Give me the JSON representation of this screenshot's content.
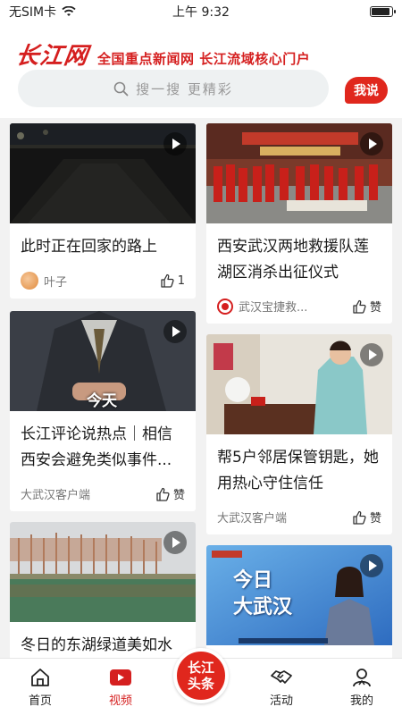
{
  "status_bar": {
    "carrier": "无SIM卡",
    "time": "上午 9:32",
    "battery_level": 0.9
  },
  "header": {
    "logo": "长江网",
    "slogan": "全国重点新闻网 长江流域核心门户",
    "search_placeholder": "搜一搜 更精彩",
    "say_button": "我说"
  },
  "feed": {
    "cards": [
      {
        "title": "此时正在回家的路上",
        "source": "叶子",
        "likes": "1",
        "thumb": "night-road"
      },
      {
        "title": "西安武汉两地救援队莲湖区消杀出征仪式",
        "source": "武汉宝捷救...",
        "likes": "赞",
        "thumb": "rescue-team"
      },
      {
        "title": "长江评论说热点｜相信西安会避免类似事件...",
        "source": "大武汉客户端",
        "likes": "赞",
        "thumb": "suit-man",
        "thumb_caption": "今天"
      },
      {
        "title": "帮5户邻居保管钥匙，她用热心守住信任",
        "source": "大武汉客户端",
        "likes": "赞",
        "thumb": "woman-keys"
      },
      {
        "title": "冬日的东湖绿道美如水",
        "source": "",
        "likes": "",
        "thumb": "east-lake"
      },
      {
        "title": "",
        "source": "",
        "likes": "",
        "thumb": "anchor",
        "thumb_caption": "今日\n大武汉"
      }
    ]
  },
  "tabbar": {
    "items": [
      {
        "label": "首页",
        "icon": "home-icon"
      },
      {
        "label": "视频",
        "icon": "video-icon"
      },
      {
        "label": "长江头条",
        "icon": "center-button"
      },
      {
        "label": "活动",
        "icon": "handshake-icon"
      },
      {
        "label": "我的",
        "icon": "person-icon"
      }
    ],
    "active_color": "#d51f1f"
  }
}
